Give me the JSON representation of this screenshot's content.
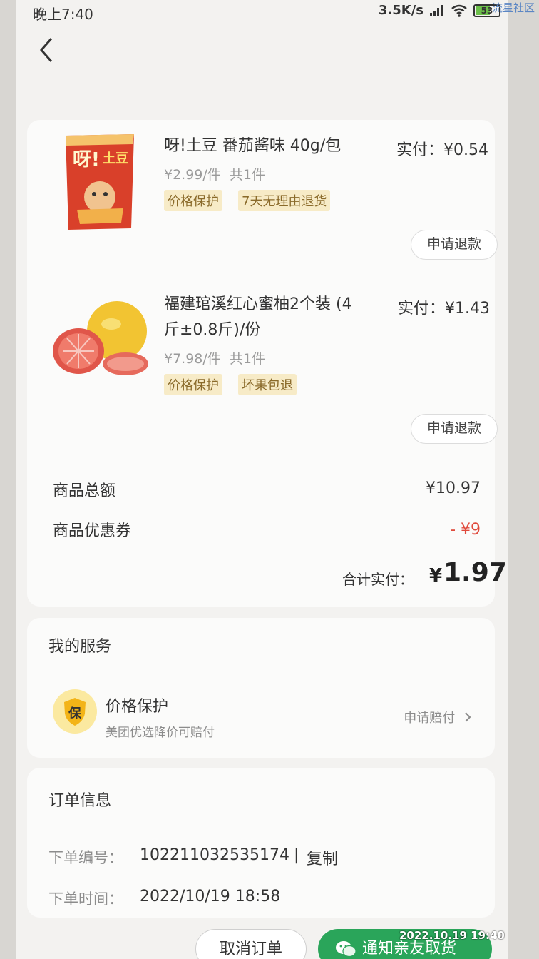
{
  "status_bar": {
    "time": "晚上7:40",
    "network_speed": "3.5K/s",
    "battery": "53"
  },
  "watermark": "流星社区",
  "items": [
    {
      "name": "呀!土豆 番茄酱味 40g/包",
      "unit_price": "¥2.99/件",
      "quantity": "共1件",
      "paid_label": "实付：",
      "paid": "¥0.54",
      "tags": [
        "价格保护",
        "7天无理由退货"
      ],
      "refund": "申请退款",
      "image": "potato-chips-bag-image"
    },
    {
      "name_line1": "福建琯溪红心蜜柚2个装 (4",
      "name_line2": "斤±0.8斤)/份",
      "unit_price": "¥7.98/件",
      "quantity": "共1件",
      "paid_label": "实付：",
      "paid": "¥1.43",
      "tags": [
        "价格保护",
        "坏果包退"
      ],
      "refund": "申请退款",
      "image": "pomelo-image"
    }
  ],
  "summary": {
    "subtotal_label": "商品总额",
    "subtotal": "¥10.97",
    "coupon_label": "商品优惠券",
    "coupon": "- ¥9",
    "total_label": "合计实付：",
    "total_currency": "¥",
    "total": "1.97"
  },
  "service": {
    "title": "我的服务",
    "icon_char": "保",
    "name": "价格保护",
    "desc": "美团优选降价可赔付",
    "link": "申请赔付"
  },
  "order_info": {
    "title": "订单信息",
    "number_label": "下单编号：",
    "number": "102211032535174",
    "separator": "|",
    "copy": "复制",
    "time_label": "下单时间：",
    "time": "2022/10/19 18:58"
  },
  "actions": {
    "cancel": "取消订单",
    "notify": "通知亲友取货"
  },
  "photo_stamp": "2022.10.19 19:40",
  "colors": {
    "accent_green": "#2aa55a",
    "discount_red": "#e04a3c",
    "tag_bg": "#f7ebc7"
  }
}
